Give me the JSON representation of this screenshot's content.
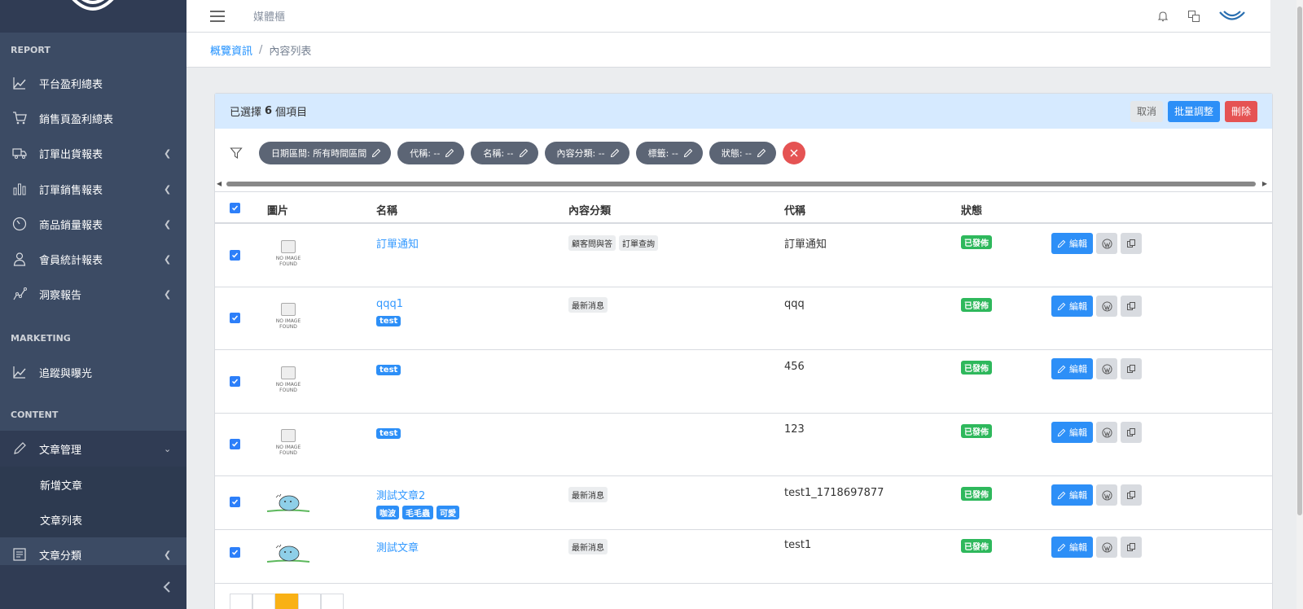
{
  "app": {
    "title": "媒體櫃"
  },
  "breadcrumb": {
    "parent": "概覽資訊",
    "separator": "/",
    "current": "內容列表"
  },
  "sidebar": {
    "sections": [
      {
        "title": "REPORT"
      },
      {
        "title": "MARKETING"
      },
      {
        "title": "CONTENT"
      }
    ],
    "items": [
      {
        "label": "平台盈利總表",
        "icon": "chart-line-icon"
      },
      {
        "label": "銷售頁盈利總表",
        "icon": "cart-icon"
      },
      {
        "label": "訂單出貨報表",
        "icon": "truck-icon"
      },
      {
        "label": "訂單銷售報表",
        "icon": "bar-chart-icon"
      },
      {
        "label": "商品銷量報表",
        "icon": "speedometer-icon"
      },
      {
        "label": "會員統計報表",
        "icon": "user-icon"
      },
      {
        "label": "洞察報告",
        "icon": "graph-icon"
      },
      {
        "label": "追蹤與曝光",
        "icon": "chart-line-icon"
      },
      {
        "label": "文章管理",
        "icon": "pencil-icon"
      },
      {
        "label": "文章分類",
        "icon": "list-icon"
      }
    ],
    "sub_items": [
      {
        "label": "新增文章"
      },
      {
        "label": "文章列表"
      }
    ]
  },
  "selection": {
    "prefix": "已選擇",
    "count": "6",
    "suffix": "個項目",
    "cancel": "取消",
    "batch": "批量調整",
    "delete": "刪除"
  },
  "filters": [
    {
      "label": "日期區間: 所有時間區間"
    },
    {
      "label": "代稱: --"
    },
    {
      "label": "名稱: --"
    },
    {
      "label": "內容分類: --"
    },
    {
      "label": "標籤: --"
    },
    {
      "label": "狀態: --"
    }
  ],
  "table": {
    "headers": {
      "image": "圖片",
      "name": "名稱",
      "category": "內容分類",
      "slug": "代稱",
      "status": "狀態"
    },
    "no_image": [
      "NO IMAGE",
      "FOUND"
    ],
    "edit_label": "編輯",
    "rows": [
      {
        "name": "訂單通知",
        "tags": [],
        "categories": [
          "顧客問與答",
          "訂單查詢"
        ],
        "slug": "訂單通知",
        "status": "已發佈",
        "image": "none"
      },
      {
        "name": "qqq1",
        "tags": [
          "test"
        ],
        "categories": [
          "最新消息"
        ],
        "slug": "qqq",
        "status": "已發佈",
        "image": "none"
      },
      {
        "name": "",
        "tags": [
          "test"
        ],
        "categories": [],
        "slug": "456",
        "status": "已發佈",
        "image": "none"
      },
      {
        "name": "",
        "tags": [
          "test"
        ],
        "categories": [],
        "slug": "123",
        "status": "已發佈",
        "image": "none"
      },
      {
        "name": "測試文章2",
        "tags": [
          "咖波",
          "毛毛蟲",
          "可愛"
        ],
        "categories": [
          "最新消息"
        ],
        "slug": "test1_1718697877",
        "status": "已發佈",
        "image": "cat"
      },
      {
        "name": "測試文章",
        "tags": [],
        "categories": [
          "最新消息"
        ],
        "slug": "test1",
        "status": "已發佈",
        "image": "cat"
      }
    ]
  },
  "colors": {
    "sidebar": "#3c4b64",
    "primary": "#2d8ff7",
    "danger": "#e55353",
    "success": "#2eb85c",
    "chip": "#5c6575"
  }
}
